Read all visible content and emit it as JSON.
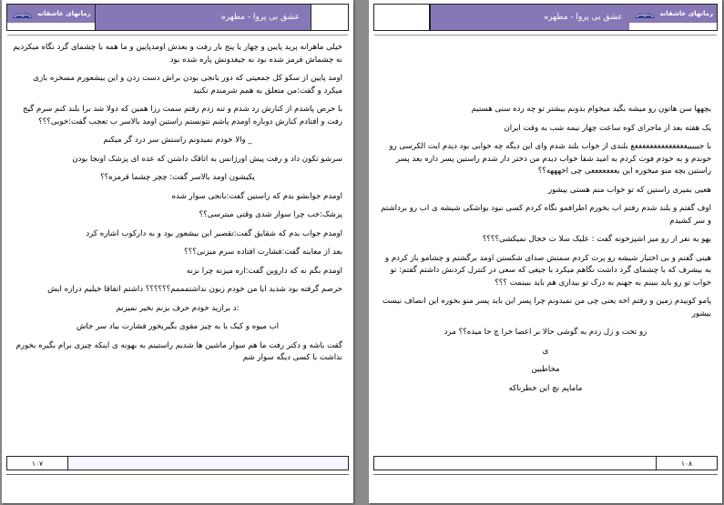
{
  "header": {
    "title": "عشق بی پروا - مطهره",
    "logo_text": "رمانهای عاشقانه"
  },
  "left_page": {
    "page_number": "۱۰۷",
    "paragraphs": [
      "خیلی ماهرانه پرید پایین و چهار یا پنج بار رفت و بعدش اومدپایین و ما همه با چشمای گرد نگاه میکردیم نه چشماش قرمز شده بود نه جیغدونش پاره شده بود",
      "اومد پایین از سکو کل جمعیتی که دور بانجی بودن براش دست زدن و این بیشعورم مسخره بازی میکرد و گفت:من متعلق به همم شرمندم نکنید",
      "با حرص پاشدم از کنارش رد شدم و تنه زدم رفتم سمت رزا همین که دولا شد برا بلند کنم سرم گیج رفت و افتادم کنارش دوباره اومدم پاشم نتونستم راستین اومد بالاسر ب تعجب گفت:خوبی؟؟؟",
      "_ والا خودم نمیدونم راستش سر درد گر میکنم",
      "سرشو تکون داد و رفت پیش اورژانس به اتاقک داشتن که عده ای پزشک اونجا بودن",
      "یکیشون اومد بالاسر گفت: چچر چشما قرمزه؟؟",
      "اومدم جوابشو بدم که راستین گفت:بانجی سوار شده",
      "پزشک:خب چرا سوار شدی وقتی میترسی؟؟",
      "اومدم جواب بدم که شقایق گفت:تقصیر این بیشعور بود و به دارکوب اشاره کرد",
      "بعد از معاینه گفت:فشارت افتاده سرم میزنی؟؟؟",
      "اومدم بگم نه که داروین گفت:اره میزنه چرا نزنه",
      "حرصم گرفته بود شدید ایا من خودم زبون نداشتمممم؟؟؟؟؟؟ داشتم اتفاقا خیلیم درازه ایش",
      ":د برازید خودم حرف بزنم نخیر نمیزنم",
      "اب میوه و کیک با به چیز مقوی بگیربخور فشارت بیاد سر جاش",
      "گفت باشه و دکتر رفت ما هم سوار ماشین ها شدیم راستینم به بهونه ی اینکه چیزی برام بگیره بخورم نذاشت با کسی دیگه سوار شم"
    ]
  },
  "right_page": {
    "page_number": "۱۰۸",
    "paragraphs": [
      "بچهها سن هاتون رو میشه بگید میخوام بدونم بیشتر تو چه رده سنی هستیم",
      "یک هفته بعد از ماجرای کوه ساعت چهار نیمه شب به وقت ایران",
      "با جیییییغغغغغغغغغغغغغغغ بلندی از خواب بلند شدم وای این دیگه چه خوابی بود دیدم ایت الکرسی رو خوندم و به خودم فوت کردم به امید شفا خواب دیدم من دختر دار شدم راستین پسر داره بعد پسر راستین بچه منو میخوره این یعععععععی چی اخهههه؟؟",
      "هعیی بمیری راستین که تو خواب منم هستی بیشور",
      "اوف گفتم و بلند شدم رفتم اب بخورم اطرافمو نگاه کردم کسی نبود یواشکی شیشه ی اب رو برداشتم و سر کشیدم",
      "یهو یه نفر از رو میز اشپزخونه گفت : علیک سلا ت خجال نمیکشی؟؟؟؟",
      "هینی گفتم و بی اختیار شیشه رو پرت کردم سمتش صدای شکستن اومد برگشتم و چشامو باز کردم و به بیشرف که با چشمای گرد داشت نگاهم میکرد با جیغی که سعی در کنترل کردنش داشتم گفتم: تو خواب تو رو باید ببینم به جهنم به درک تو بیداری هم باید ببینمت ؟؟؟",
      "پامو کوبیدم زمین و رفتم اخه یعنی چی من نمیدونم چرا پسر این باید پسر منو بخوره این انصاف نیست بیشور",
      "رو تخت و زل زدم به گوشی حالا بر اعصا خرا چ حا میده؟؟ مرد",
      "ی",
      "مخاطبین",
      "ماماپم نچ این خطرناکه"
    ]
  }
}
